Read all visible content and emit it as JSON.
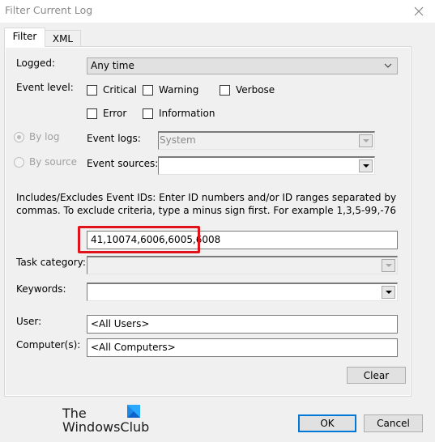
{
  "window": {
    "title": "Filter Current Log"
  },
  "tabs": [
    {
      "label": "Filter",
      "active": true
    },
    {
      "label": "XML",
      "active": false
    }
  ],
  "filter": {
    "logged": {
      "label": "Logged:",
      "value": "Any time"
    },
    "event_level": {
      "label": "Event level:",
      "options": [
        {
          "label": "Critical",
          "checked": false
        },
        {
          "label": "Warning",
          "checked": false
        },
        {
          "label": "Verbose",
          "checked": false
        },
        {
          "label": "Error",
          "checked": false
        },
        {
          "label": "Information",
          "checked": false
        }
      ]
    },
    "by_log": {
      "label": "By log",
      "selected": true
    },
    "by_source": {
      "label": "By source",
      "selected": false
    },
    "event_logs": {
      "label": "Event logs:",
      "value": "System"
    },
    "event_sources": {
      "label": "Event sources:",
      "value": ""
    },
    "event_ids": {
      "help": "Includes/Excludes Event IDs: Enter ID numbers and/or ID ranges separated by commas. To exclude criteria, type a minus sign first. For example 1,3,5-99,-76",
      "value": "41,10074,6006,6005,6008"
    },
    "task_category": {
      "label": "Task category:",
      "value": ""
    },
    "keywords": {
      "label": "Keywords:",
      "value": ""
    },
    "user": {
      "label": "User:",
      "value": "<All Users>"
    },
    "computers": {
      "label": "Computer(s):",
      "value": "<All Computers>"
    },
    "clear_label": "Clear"
  },
  "footer": {
    "ok_label": "OK",
    "cancel_label": "Cancel"
  },
  "watermark": {
    "line1": "The",
    "line2": "WindowsClub"
  },
  "colors": {
    "highlight": "#e0121a",
    "default_button_border": "#0078d7",
    "logo_blue": "#1e90ff"
  }
}
